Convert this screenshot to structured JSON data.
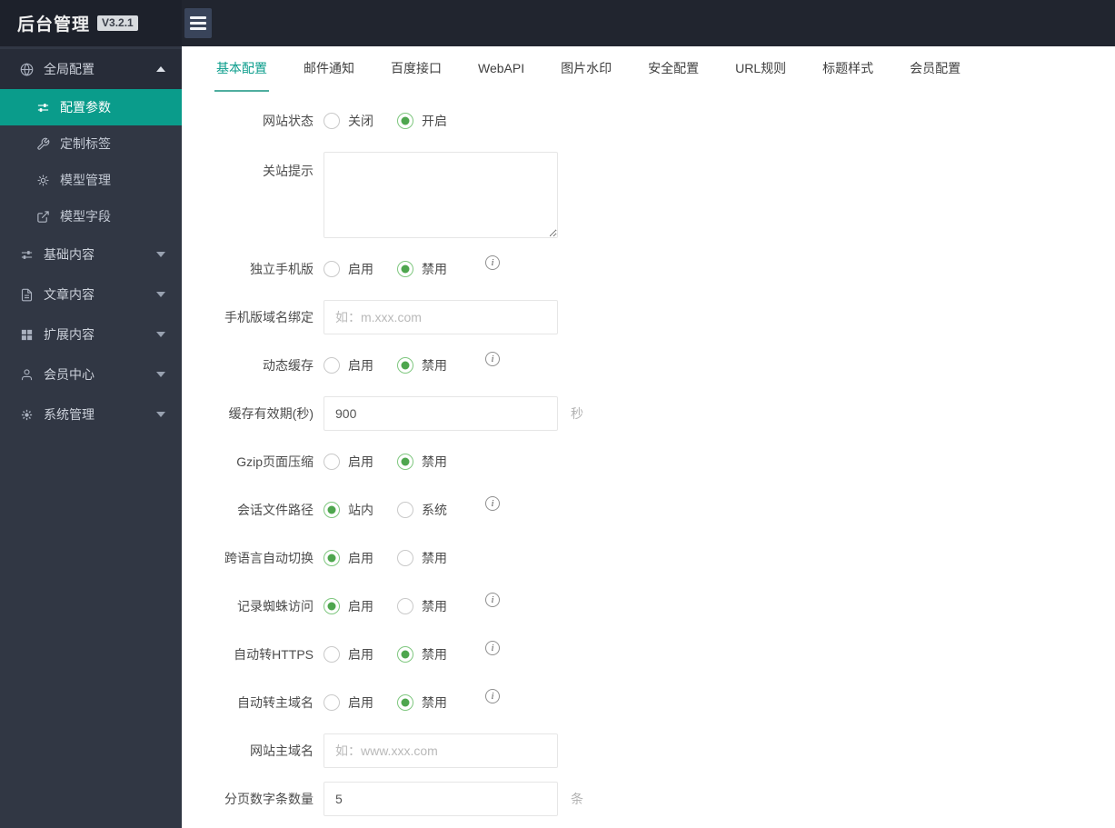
{
  "header": {
    "title": "后台管理",
    "version": "V3.2.1"
  },
  "sidebar": {
    "groups": [
      {
        "label": "全局配置",
        "icon": "globe-icon",
        "expanded": true,
        "items": [
          {
            "label": "配置参数",
            "icon": "sliders-icon",
            "active": true
          },
          {
            "label": "定制标签",
            "icon": "wrench-icon",
            "active": false
          },
          {
            "label": "模型管理",
            "icon": "cog-icon",
            "active": false
          },
          {
            "label": "模型字段",
            "icon": "external-link-icon",
            "active": false
          }
        ]
      },
      {
        "label": "基础内容",
        "icon": "sliders-icon",
        "expanded": false
      },
      {
        "label": "文章内容",
        "icon": "document-icon",
        "expanded": false
      },
      {
        "label": "扩展内容",
        "icon": "grid-icon",
        "expanded": false
      },
      {
        "label": "会员中心",
        "icon": "user-icon",
        "expanded": false
      },
      {
        "label": "系统管理",
        "icon": "gear-icon",
        "expanded": false
      }
    ]
  },
  "tabs": [
    {
      "label": "基本配置",
      "active": true
    },
    {
      "label": "邮件通知",
      "active": false
    },
    {
      "label": "百度接口",
      "active": false
    },
    {
      "label": "WebAPI",
      "active": false
    },
    {
      "label": "图片水印",
      "active": false
    },
    {
      "label": "安全配置",
      "active": false
    },
    {
      "label": "URL规则",
      "active": false
    },
    {
      "label": "标题样式",
      "active": false
    },
    {
      "label": "会员配置",
      "active": false
    }
  ],
  "form": {
    "rows": [
      {
        "label": "网站状态",
        "type": "radio",
        "info": false,
        "options": [
          {
            "label": "关闭",
            "checked": false
          },
          {
            "label": "开启",
            "checked": true
          }
        ]
      },
      {
        "label": "关站提示",
        "type": "textarea",
        "value": ""
      },
      {
        "label": "独立手机版",
        "type": "radio",
        "info": true,
        "options": [
          {
            "label": "启用",
            "checked": false
          },
          {
            "label": "禁用",
            "checked": true
          }
        ]
      },
      {
        "label": "手机版域名绑定",
        "type": "input",
        "value": "",
        "placeholder": "如：m.xxx.com"
      },
      {
        "label": "动态缓存",
        "type": "radio",
        "info": true,
        "options": [
          {
            "label": "启用",
            "checked": false
          },
          {
            "label": "禁用",
            "checked": true
          }
        ]
      },
      {
        "label": "缓存有效期(秒)",
        "type": "input",
        "value": "900",
        "suffix": "秒"
      },
      {
        "label": "Gzip页面压缩",
        "type": "radio",
        "info": false,
        "options": [
          {
            "label": "启用",
            "checked": false
          },
          {
            "label": "禁用",
            "checked": true
          }
        ]
      },
      {
        "label": "会话文件路径",
        "type": "radio",
        "info": true,
        "options": [
          {
            "label": "站内",
            "checked": true
          },
          {
            "label": "系统",
            "checked": false
          }
        ]
      },
      {
        "label": "跨语言自动切换",
        "type": "radio",
        "info": false,
        "options": [
          {
            "label": "启用",
            "checked": true
          },
          {
            "label": "禁用",
            "checked": false
          }
        ]
      },
      {
        "label": "记录蜘蛛访问",
        "type": "radio",
        "info": true,
        "options": [
          {
            "label": "启用",
            "checked": true
          },
          {
            "label": "禁用",
            "checked": false
          }
        ]
      },
      {
        "label": "自动转HTTPS",
        "type": "radio",
        "info": true,
        "options": [
          {
            "label": "启用",
            "checked": false
          },
          {
            "label": "禁用",
            "checked": true
          }
        ]
      },
      {
        "label": "自动转主域名",
        "type": "radio",
        "info": true,
        "options": [
          {
            "label": "启用",
            "checked": false
          },
          {
            "label": "禁用",
            "checked": true
          }
        ]
      },
      {
        "label": "网站主域名",
        "type": "input",
        "value": "",
        "placeholder": "如：www.xxx.com"
      },
      {
        "label": "分页数字条数量",
        "type": "input",
        "value": "5",
        "suffix": "条"
      }
    ]
  },
  "colors": {
    "accent": "#0a9c8b",
    "radio_checked": "#4ea64e",
    "header_bg": "#21252f",
    "sidebar_bg": "#313744"
  }
}
